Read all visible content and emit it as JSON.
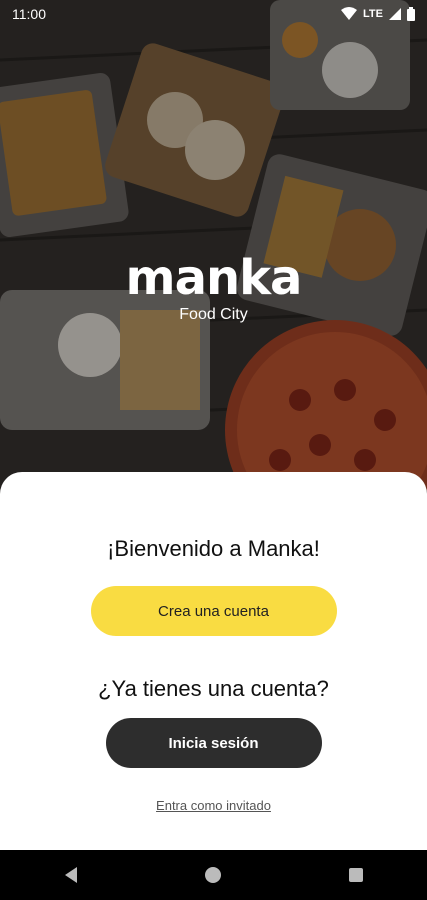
{
  "status_bar": {
    "time": "11:00",
    "network": "LTE"
  },
  "brand": {
    "logo_text": "manka",
    "tagline": "Food City"
  },
  "welcome": {
    "title": "¡Bienvenido a Manka!",
    "create_account_label": "Crea una cuenta",
    "have_account_text": "¿Ya tienes una cuenta?",
    "login_label": "Inicia sesión",
    "guest_label": "Entra como invitado"
  },
  "colors": {
    "accent": "#f9dc42",
    "dark_button": "#2d2d2d",
    "sheet": "#ffffff"
  },
  "nav_bar": {
    "icons": [
      "back-icon",
      "home-icon",
      "recents-icon"
    ]
  }
}
